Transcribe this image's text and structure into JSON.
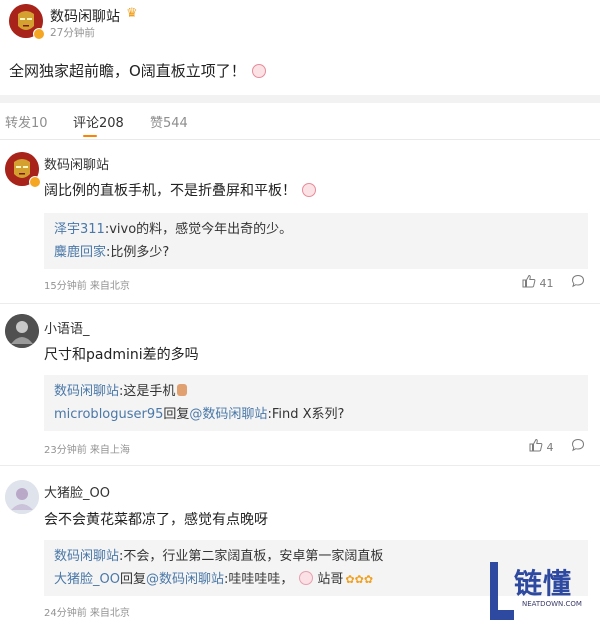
{
  "post": {
    "author": "数码闲聊站",
    "time": "27分钟前",
    "text": "全网独家超前瞻，O阔直板立项了！"
  },
  "tabs": {
    "repost": "转发10",
    "comment": "评论208",
    "like": "赞544"
  },
  "comments": [
    {
      "user": "数码闲聊站",
      "text": "阔比例的直板手机，不是折叠屏和平板！",
      "replies": [
        {
          "user": "泽宇311",
          "text": ":vivo的料，感觉今年出奇的少。"
        },
        {
          "user": "麋鹿回家",
          "text": ":比例多少?"
        }
      ],
      "meta": "15分钟前 来自北京",
      "likes": "41"
    },
    {
      "user": "小语语_",
      "text": "尺寸和padmini差的多吗",
      "replies": [
        {
          "user": "数码闲聊站",
          "text": ":这是手机"
        },
        {
          "user": "microbloguser95",
          "mid": "回复",
          "target": "@数码闲聊站",
          "text": ":Find X系列?"
        }
      ],
      "meta": "23分钟前 来自上海",
      "likes": "4"
    },
    {
      "user": "大猪脸_OO",
      "text": "会不会黄花菜都凉了，感觉有点晚呀",
      "replies": [
        {
          "user": "数码闲聊站",
          "text": ":不会，行业第二家阔直板，安卓第一家阔直板"
        },
        {
          "user": "大猪脸_OO",
          "mid": "回复",
          "target": "@数码闲聊站",
          "text": ":哇哇哇哇，",
          "tail": "站哥"
        }
      ],
      "meta": "24分钟前 来自北京"
    }
  ],
  "watermark": {
    "text": "链懂",
    "sub": "NEATDOWN.COM"
  },
  "colors": {
    "link": "#4a78a8",
    "accent": "#ff8200",
    "badge": "#f5a623",
    "watermark": "#2e4aa0"
  }
}
